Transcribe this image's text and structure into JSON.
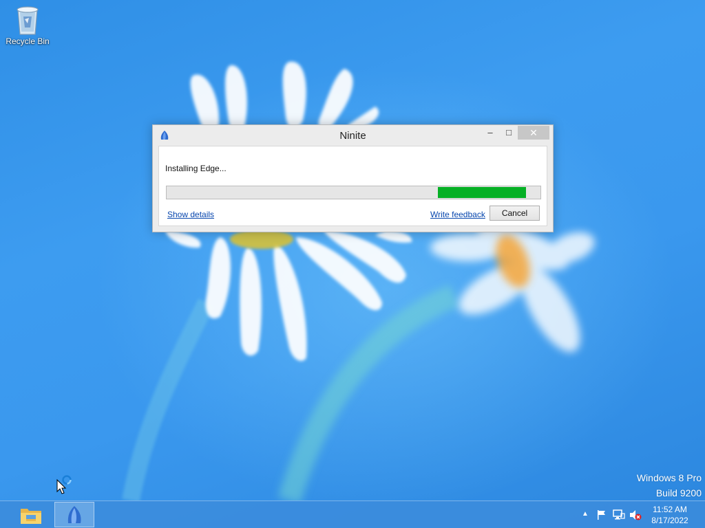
{
  "desktop": {
    "icons": [
      {
        "label": "Recycle Bin",
        "icon": "recycle-bin-icon"
      }
    ],
    "watermark": {
      "line1": "Windows 8 Pro",
      "line2": "Build 9200"
    }
  },
  "dialog": {
    "title": "Ninite",
    "app_icon": "ninite-icon",
    "title_buttons": {
      "minimize": "–",
      "maximize": "□",
      "close": "✕"
    },
    "status_text": "Installing Edge...",
    "progress": {
      "indeterminate": true,
      "segment_start": 0.725,
      "segment_end": 0.96,
      "color": "#06b025"
    },
    "show_details_label": "Show details",
    "write_feedback_label": "Write feedback",
    "cancel_label": "Cancel"
  },
  "taskbar": {
    "pinned": [
      {
        "name": "file-explorer",
        "icon": "folder-icon",
        "active": false
      },
      {
        "name": "ninite",
        "icon": "ninite-icon",
        "active": true
      }
    ],
    "tray": {
      "show_hidden_icon": "▲",
      "icons": [
        "action-center-flag-icon",
        "network-icon",
        "volume-muted-icon"
      ],
      "time": "11:52 AM",
      "date": "8/17/2022"
    }
  },
  "colors": {
    "desktop_blue": "#3a98ee",
    "progress_green": "#06b025",
    "link_blue": "#0645ad"
  }
}
